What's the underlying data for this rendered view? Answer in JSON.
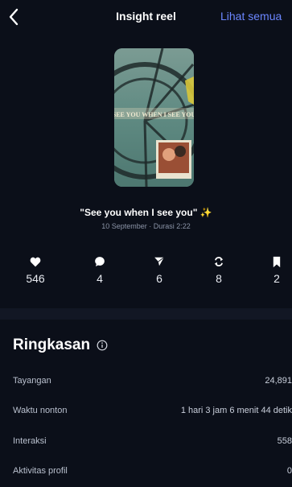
{
  "header": {
    "title": "Insight reel",
    "see_all": "Lihat semua"
  },
  "reel": {
    "thumbnail_text": "SEE YOU WHEN I SEE YOU",
    "caption": "\"See you when I see you\"",
    "caption_emoji": "✨",
    "meta": "10 September · Durasi 2:22"
  },
  "stats": [
    {
      "icon": "heart-icon",
      "value": "546"
    },
    {
      "icon": "comment-icon",
      "value": "4"
    },
    {
      "icon": "send-icon",
      "value": "6"
    },
    {
      "icon": "repost-icon",
      "value": "8"
    },
    {
      "icon": "bookmark-icon",
      "value": "2"
    }
  ],
  "summary": {
    "title": "Ringkasan",
    "rows": [
      {
        "label": "Tayangan",
        "value": "24,891"
      },
      {
        "label": "Waktu nonton",
        "value": "1 hari 3 jam 6 menit 44 detik"
      },
      {
        "label": "Interaksi",
        "value": "558"
      },
      {
        "label": "Aktivitas profil",
        "value": "0"
      }
    ]
  },
  "colors": {
    "background": "#0b0f19",
    "accent": "#6b86ff",
    "emoji": "#f5e34a"
  }
}
